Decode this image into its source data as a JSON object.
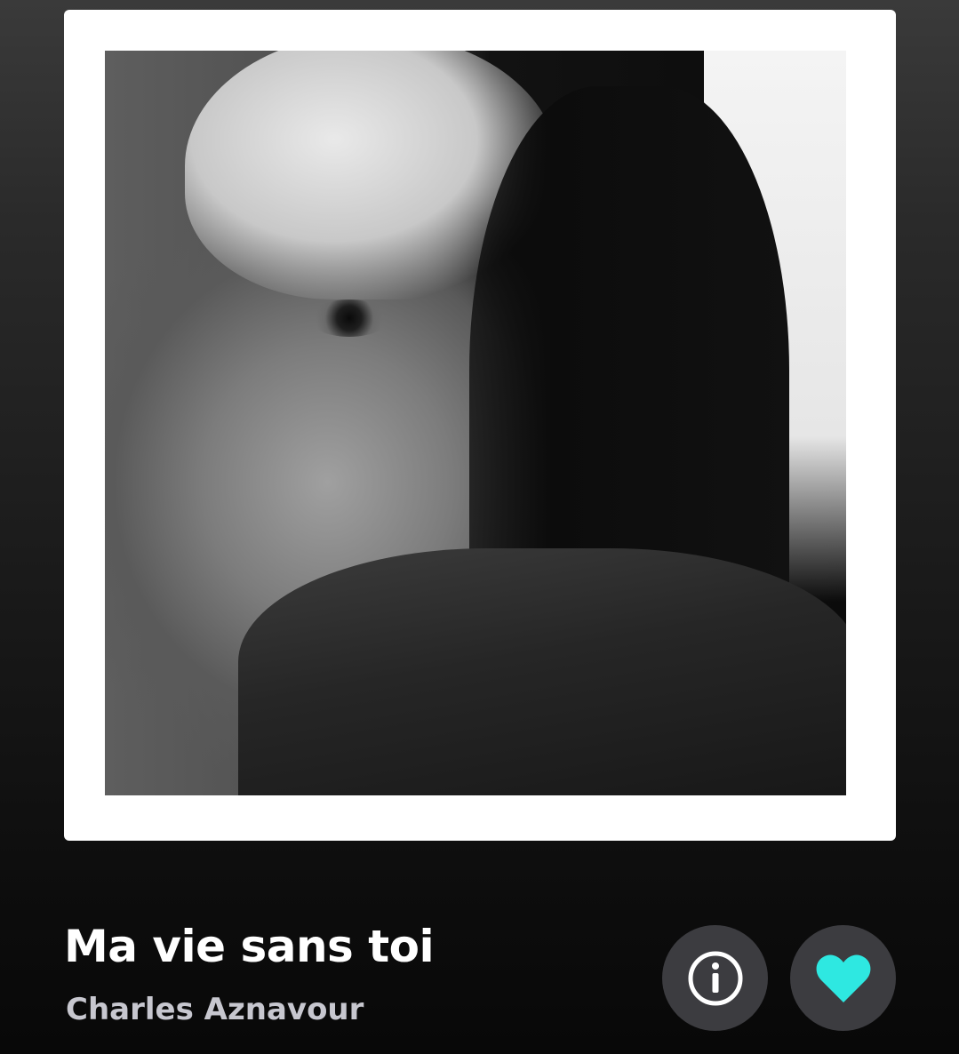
{
  "track": {
    "title": "Ma vie sans toi",
    "artist": "Charles Aznavour"
  },
  "artwork": {
    "description_icon": "album-cover-portrait"
  },
  "actions": {
    "info": {
      "icon": "info-icon"
    },
    "favorite": {
      "icon": "heart-icon",
      "active": true
    }
  },
  "colors": {
    "accent": "#2ee8e1",
    "button_bg": "#3c3c40",
    "title_text": "#ffffff",
    "artist_text": "#c7c7cf"
  }
}
